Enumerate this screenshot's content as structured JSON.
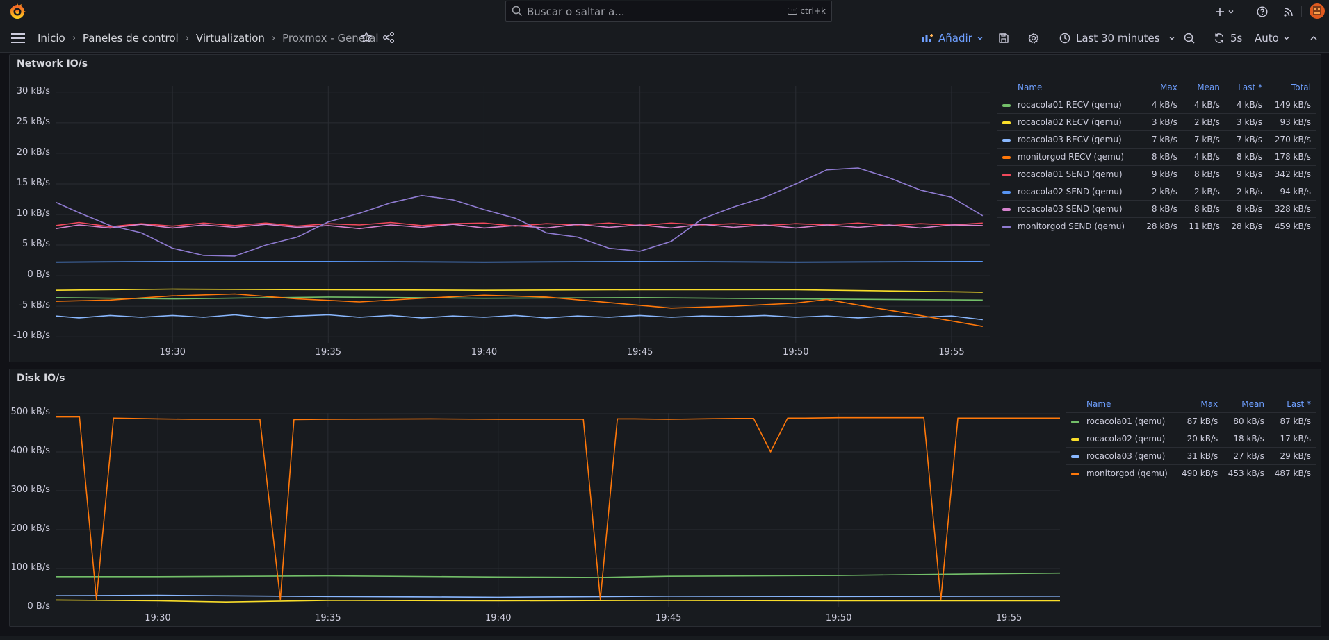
{
  "search": {
    "placeholder": "Buscar o saltar a...",
    "shortcut": "ctrl+k"
  },
  "breadcrumb": {
    "items": [
      "Inicio",
      "Paneles de control",
      "Virtualization",
      "Proxmox - General"
    ]
  },
  "toolbar": {
    "add_label": "Añadir",
    "time_range": "Last 30 minutes",
    "refresh_interval": "5s",
    "refresh_mode": "Auto"
  },
  "colors": {
    "accent": "#6e9fff",
    "green": "#73bf69",
    "yellow": "#fade2a",
    "lightblue": "#8ab8ff",
    "orange": "#ff780a",
    "red": "#f2495c",
    "blue": "#5794f2",
    "pink": "#d683ce",
    "purple": "#8f7bd1"
  },
  "network": {
    "title": "Network IO/s",
    "legend_headers": {
      "name": "Name",
      "max": "Max",
      "mean": "Mean",
      "last": "Last *",
      "total": "Total"
    },
    "legend": [
      {
        "name": "rocacola01 RECV (qemu)",
        "color": "#73bf69",
        "max": "4 kB/s",
        "mean": "4 kB/s",
        "last": "4 kB/s",
        "total": "149 kB/s"
      },
      {
        "name": "rocacola02 RECV (qemu)",
        "color": "#fade2a",
        "max": "3 kB/s",
        "mean": "2 kB/s",
        "last": "3 kB/s",
        "total": "93 kB/s"
      },
      {
        "name": "rocacola03 RECV (qemu)",
        "color": "#8ab8ff",
        "max": "7 kB/s",
        "mean": "7 kB/s",
        "last": "7 kB/s",
        "total": "270 kB/s"
      },
      {
        "name": "monitorgod RECV (qemu)",
        "color": "#ff780a",
        "max": "8 kB/s",
        "mean": "4 kB/s",
        "last": "8 kB/s",
        "total": "178 kB/s"
      },
      {
        "name": "rocacola01 SEND (qemu)",
        "color": "#f2495c",
        "max": "9 kB/s",
        "mean": "8 kB/s",
        "last": "9 kB/s",
        "total": "342 kB/s"
      },
      {
        "name": "rocacola02 SEND (qemu)",
        "color": "#5794f2",
        "max": "2 kB/s",
        "mean": "2 kB/s",
        "last": "2 kB/s",
        "total": "94 kB/s"
      },
      {
        "name": "rocacola03 SEND (qemu)",
        "color": "#d683ce",
        "max": "8 kB/s",
        "mean": "8 kB/s",
        "last": "8 kB/s",
        "total": "328 kB/s"
      },
      {
        "name": "monitorgod SEND (qemu)",
        "color": "#8f7bd1",
        "max": "28 kB/s",
        "mean": "11 kB/s",
        "last": "28 kB/s",
        "total": "459 kB/s"
      }
    ]
  },
  "disk": {
    "title": "Disk IO/s",
    "legend_headers": {
      "name": "Name",
      "max": "Max",
      "mean": "Mean",
      "last": "Last *"
    },
    "legend": [
      {
        "name": "rocacola01 (qemu)",
        "color": "#73bf69",
        "max": "87 kB/s",
        "mean": "80 kB/s",
        "last": "87 kB/s"
      },
      {
        "name": "rocacola02 (qemu)",
        "color": "#fade2a",
        "max": "20 kB/s",
        "mean": "18 kB/s",
        "last": "17 kB/s"
      },
      {
        "name": "rocacola03 (qemu)",
        "color": "#8ab8ff",
        "max": "31 kB/s",
        "mean": "27 kB/s",
        "last": "29 kB/s"
      },
      {
        "name": "monitorgod (qemu)",
        "color": "#ff780a",
        "max": "490 kB/s",
        "mean": "453 kB/s",
        "last": "487 kB/s"
      }
    ]
  },
  "chart_data": [
    {
      "type": "line",
      "title": "Network IO/s",
      "x_ticks": [
        "19:30",
        "19:35",
        "19:40",
        "19:45",
        "19:50",
        "19:55"
      ],
      "x_range_minutes": [
        26.25,
        56.25
      ],
      "y_ticks": [
        "30 kB/s",
        "25 kB/s",
        "20 kB/s",
        "15 kB/s",
        "10 kB/s",
        "5 kB/s",
        "0 B/s",
        "-5 kB/s",
        "-10 kB/s"
      ],
      "ylim": [
        -11,
        31
      ],
      "grid": true,
      "legend_placement": "right",
      "series": [
        {
          "name": "rocacola01 RECV (qemu)",
          "color": "#73bf69",
          "x": [
            26.25,
            30,
            35,
            40,
            45,
            50,
            56
          ],
          "values": [
            -3.6,
            -3.8,
            -3.5,
            -3.7,
            -3.6,
            -3.8,
            -4.0
          ]
        },
        {
          "name": "rocacola02 RECV (qemu)",
          "color": "#fade2a",
          "x": [
            26.25,
            30,
            35,
            40,
            45,
            50,
            56
          ],
          "values": [
            -2.4,
            -2.2,
            -2.3,
            -2.4,
            -2.3,
            -2.3,
            -2.7
          ]
        },
        {
          "name": "rocacola03 RECV (qemu)",
          "color": "#8ab8ff",
          "x": [
            26.25,
            27,
            28,
            29,
            30,
            31,
            32,
            33,
            34,
            35,
            36,
            37,
            38,
            39,
            40,
            41,
            42,
            43,
            44,
            45,
            46,
            47,
            48,
            49,
            50,
            51,
            52,
            53,
            54,
            55,
            56
          ],
          "values": [
            -6.6,
            -6.9,
            -6.5,
            -6.8,
            -6.5,
            -6.8,
            -6.4,
            -6.9,
            -6.6,
            -6.4,
            -6.8,
            -6.5,
            -6.9,
            -6.6,
            -6.8,
            -6.5,
            -6.9,
            -6.6,
            -6.8,
            -6.5,
            -6.8,
            -6.6,
            -6.7,
            -6.5,
            -6.8,
            -6.6,
            -6.9,
            -6.6,
            -6.8,
            -6.6,
            -7.2
          ]
        },
        {
          "name": "monitorgod RECV (qemu)",
          "color": "#ff780a",
          "x": [
            26.25,
            28,
            30,
            32,
            34,
            36,
            38,
            40,
            42,
            44,
            46,
            48,
            50,
            51,
            52,
            54,
            56
          ],
          "values": [
            -4.2,
            -4.0,
            -3.3,
            -3.0,
            -3.8,
            -4.3,
            -3.7,
            -3.2,
            -3.5,
            -4.4,
            -5.3,
            -5.0,
            -4.5,
            -3.9,
            -4.8,
            -6.5,
            -8.3
          ]
        },
        {
          "name": "rocacola01 SEND (qemu)",
          "color": "#f2495c",
          "x": [
            26.25,
            27,
            28,
            29,
            30,
            31,
            32,
            33,
            34,
            35,
            36,
            37,
            38,
            39,
            40,
            41,
            42,
            43,
            44,
            45,
            46,
            47,
            48,
            49,
            50,
            51,
            52,
            53,
            54,
            55,
            56
          ],
          "values": [
            8.2,
            8.7,
            8.0,
            8.5,
            8.1,
            8.6,
            8.2,
            8.6,
            8.1,
            8.5,
            8.3,
            8.7,
            8.2,
            8.5,
            8.6,
            8.1,
            8.5,
            8.3,
            8.6,
            8.2,
            8.6,
            8.3,
            8.5,
            8.2,
            8.5,
            8.3,
            8.6,
            8.2,
            8.5,
            8.3,
            8.6
          ]
        },
        {
          "name": "rocacola02 SEND (qemu)",
          "color": "#5794f2",
          "x": [
            26.25,
            30,
            35,
            40,
            45,
            50,
            56
          ],
          "values": [
            2.2,
            2.3,
            2.3,
            2.2,
            2.3,
            2.2,
            2.3
          ]
        },
        {
          "name": "rocacola03 SEND (qemu)",
          "color": "#d683ce",
          "x": [
            26.25,
            27,
            28,
            29,
            30,
            31,
            32,
            33,
            34,
            35,
            36,
            37,
            38,
            39,
            40,
            41,
            42,
            43,
            44,
            45,
            46,
            47,
            48,
            49,
            50,
            51,
            52,
            53,
            54,
            55,
            56
          ],
          "values": [
            7.7,
            8.3,
            7.8,
            8.4,
            7.8,
            8.3,
            7.9,
            8.4,
            7.9,
            8.2,
            7.7,
            8.3,
            7.9,
            8.4,
            7.8,
            8.2,
            7.8,
            8.4,
            7.9,
            8.3,
            7.8,
            8.4,
            7.9,
            8.3,
            7.8,
            8.3,
            7.9,
            8.3,
            7.8,
            8.3,
            8.2
          ]
        },
        {
          "name": "monitorgod SEND (qemu)",
          "color": "#8f7bd1",
          "x": [
            26.25,
            27,
            28,
            29,
            30,
            31,
            32,
            33,
            34,
            35,
            36,
            37,
            38,
            39,
            40,
            41,
            42,
            43,
            44,
            45,
            46,
            47,
            48,
            49,
            50,
            51,
            52,
            53,
            54,
            55,
            56
          ],
          "values": [
            12.0,
            10.3,
            8.2,
            7.0,
            4.5,
            3.3,
            3.2,
            5.0,
            6.3,
            8.8,
            10.2,
            11.9,
            13.1,
            12.4,
            10.8,
            9.4,
            7.0,
            6.3,
            4.5,
            4.0,
            5.6,
            9.3,
            11.2,
            12.8,
            15.0,
            17.3,
            17.6,
            16.0,
            14.0,
            12.8,
            9.8
          ]
        }
      ]
    },
    {
      "type": "line",
      "title": "Disk IO/s",
      "x_ticks": [
        "19:30",
        "19:35",
        "19:40",
        "19:45",
        "19:50",
        "19:55"
      ],
      "x_range_minutes": [
        27,
        56.5
      ],
      "y_ticks": [
        "500 kB/s",
        "400 kB/s",
        "300 kB/s",
        "200 kB/s",
        "100 kB/s",
        "0 B/s"
      ],
      "ylim": [
        0,
        500
      ],
      "grid": true,
      "legend_placement": "right",
      "series": [
        {
          "name": "rocacola01 (qemu)",
          "color": "#73bf69",
          "x": [
            27,
            30,
            35,
            40,
            43,
            45,
            50,
            53,
            56.5
          ],
          "values": [
            79,
            79,
            81,
            78,
            77,
            80,
            82,
            85,
            88
          ]
        },
        {
          "name": "rocacola02 (qemu)",
          "color": "#fade2a",
          "x": [
            27,
            30,
            32,
            35,
            40,
            45,
            50,
            56.5
          ],
          "values": [
            19,
            17,
            14,
            18,
            17,
            18,
            17,
            17
          ]
        },
        {
          "name": "rocacola03 (qemu)",
          "color": "#8ab8ff",
          "x": [
            27,
            30,
            35,
            38,
            40,
            45,
            50,
            56.5
          ],
          "values": [
            30,
            31,
            28,
            27,
            26,
            29,
            28,
            29
          ]
        },
        {
          "name": "monitorgod (qemu)",
          "color": "#ff780a",
          "x": [
            27,
            27.7,
            28.2,
            28.7,
            30,
            31,
            33,
            33.6,
            34,
            35,
            38,
            40,
            41,
            42.5,
            43,
            43.5,
            44,
            45,
            47,
            47.5,
            48,
            48.5,
            49,
            50,
            51,
            52.5,
            53,
            53.5,
            54,
            55,
            56.5
          ],
          "values": [
            490,
            490,
            20,
            487,
            485,
            484,
            484,
            20,
            483,
            484,
            485,
            484,
            484,
            484,
            20,
            485,
            485,
            484,
            486,
            486,
            400,
            487,
            487,
            488,
            488,
            488,
            20,
            487,
            487,
            487,
            487
          ]
        }
      ]
    }
  ]
}
